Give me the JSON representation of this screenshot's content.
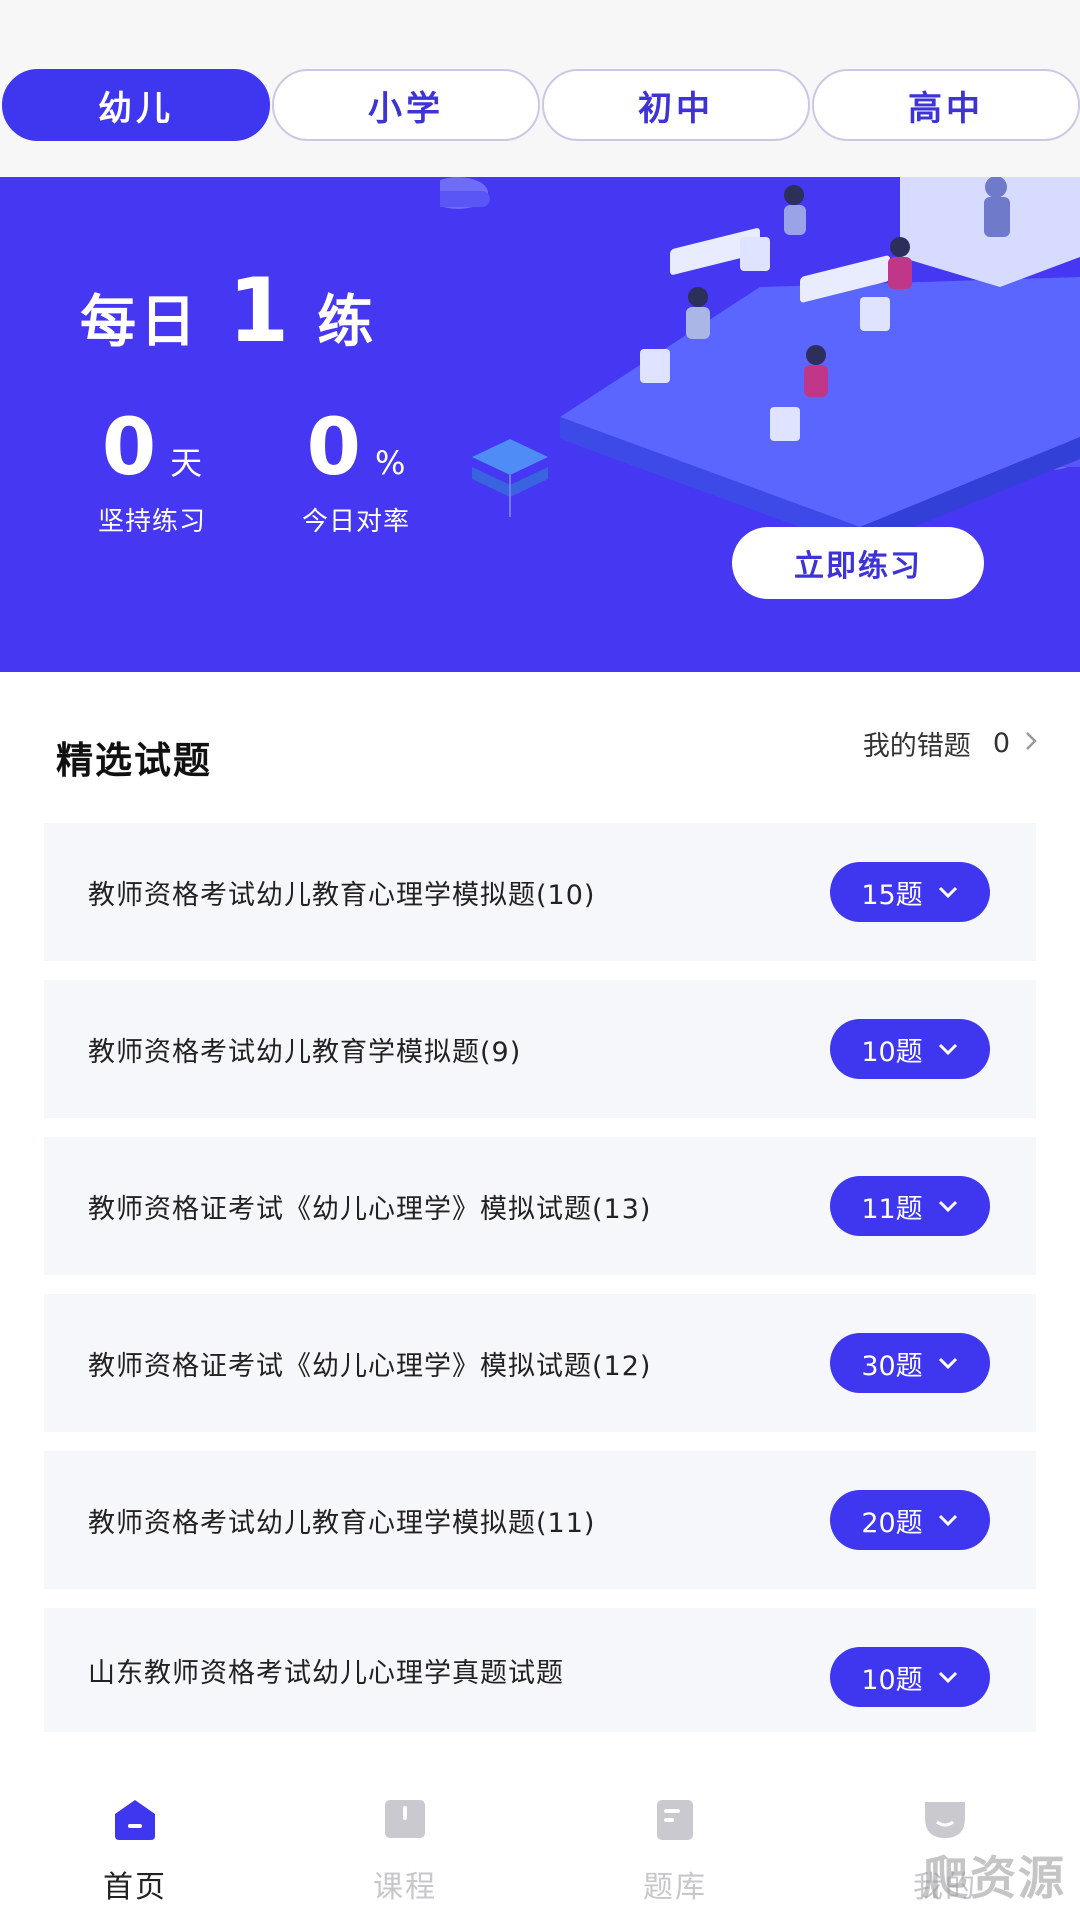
{
  "colors": {
    "accent": "#3f36f0",
    "banner": "#4537f2",
    "card": "#f6f7fa"
  },
  "tabs": [
    {
      "label": "幼儿",
      "active": true
    },
    {
      "label": "小学",
      "active": false
    },
    {
      "label": "初中",
      "active": false
    },
    {
      "label": "高中",
      "active": false
    }
  ],
  "banner": {
    "title_pre": "每日",
    "title_num": "1",
    "title_post": "练",
    "streak": {
      "value": "0",
      "unit": "天",
      "label": "坚持练习"
    },
    "accuracy": {
      "value": "0",
      "unit": "%",
      "label": "今日对率"
    },
    "button": "立即练习"
  },
  "section": {
    "title": "精选试题",
    "wrong_label": "我的错题",
    "wrong_count": "0"
  },
  "exams": [
    {
      "title": "教师资格考试幼儿教育心理学模拟题(10)",
      "count": "15题"
    },
    {
      "title": "教师资格考试幼儿教育学模拟题(9)",
      "count": "10题"
    },
    {
      "title": "教师资格证考试《幼儿心理学》模拟试题(13)",
      "count": "11题"
    },
    {
      "title": "教师资格证考试《幼儿心理学》模拟试题(12)",
      "count": "30题"
    },
    {
      "title": "教师资格考试幼儿教育心理学模拟题(11)",
      "count": "20题"
    },
    {
      "title": "山东教师资格考试幼儿心理学真题试题",
      "count": "10题"
    }
  ],
  "nav": [
    {
      "label": "首页",
      "icon": "home-icon",
      "active": true
    },
    {
      "label": "课程",
      "icon": "book-icon",
      "active": false
    },
    {
      "label": "题库",
      "icon": "question-bank-icon",
      "active": false
    },
    {
      "label": "我的",
      "icon": "profile-icon",
      "active": false
    }
  ],
  "watermark": "爬资源"
}
